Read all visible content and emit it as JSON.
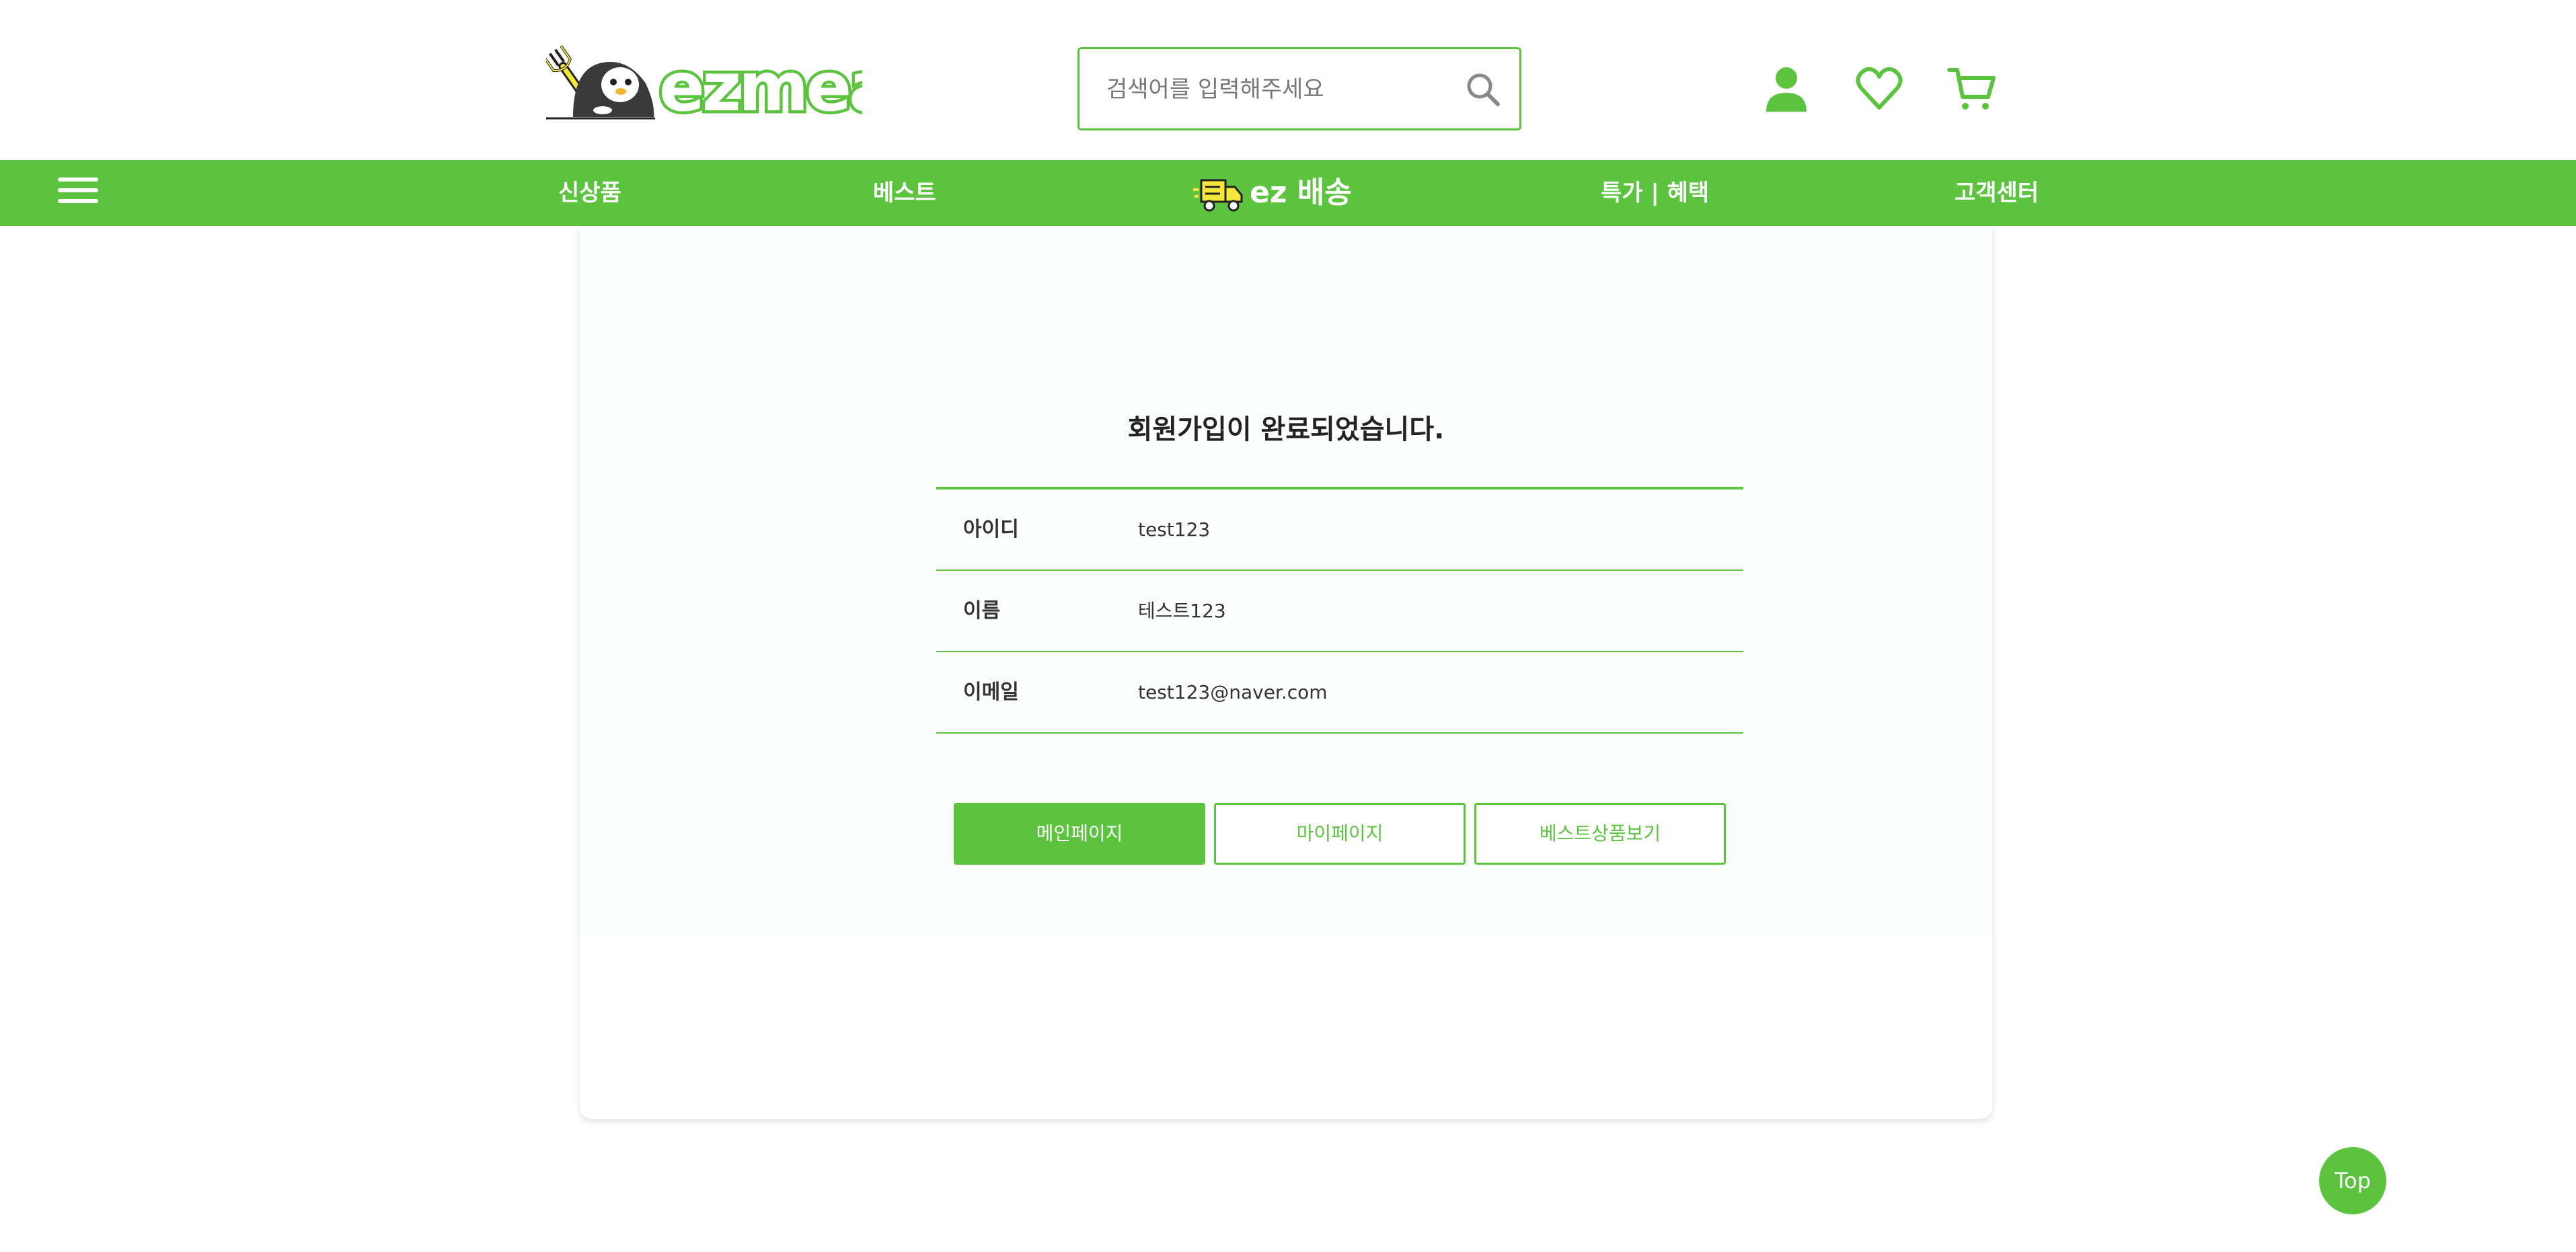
{
  "brand": {
    "logo_text": "ezmeal",
    "primary_color": "#5cc33f",
    "logo_yellow": "#f5e63b"
  },
  "header": {
    "search": {
      "placeholder": "검색어를 입력해주세요",
      "value": "",
      "icon": "search-icon"
    },
    "icons": [
      "user-icon",
      "heart-icon",
      "cart-icon"
    ]
  },
  "nav": {
    "menu_icon": "hamburger-icon",
    "items": [
      {
        "label": "신상품"
      },
      {
        "label": "베스트"
      },
      {
        "label": "ez 배송",
        "icon": "delivery-truck-icon"
      },
      {
        "label": "특가 | 혜택"
      },
      {
        "label": "고객센터"
      }
    ]
  },
  "signup": {
    "title": "회원가입이 완료되었습니다.",
    "rows": [
      {
        "label": "아이디",
        "value": "test123"
      },
      {
        "label": "이름",
        "value": "테스트123"
      },
      {
        "label": "이메일",
        "value": "test123@naver.com"
      }
    ],
    "buttons": {
      "main": "메인페이지",
      "mypage": "마이페이지",
      "best": "베스트상품보기"
    }
  },
  "top_button": {
    "label": "Top"
  }
}
